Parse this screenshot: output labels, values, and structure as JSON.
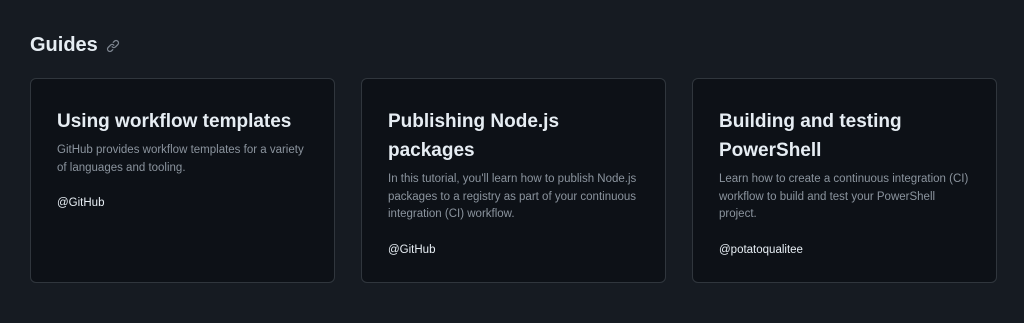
{
  "section": {
    "title": "Guides",
    "link_icon": "link-icon"
  },
  "cards": [
    {
      "title": "Using workflow templates",
      "description": "GitHub provides workflow templates for a variety of languages and tooling.",
      "author": "@GitHub"
    },
    {
      "title": "Publishing Node.js packages",
      "description": "In this tutorial, you'll learn how to publish Node.js packages to a registry as part of your continuous integration (CI) workflow.",
      "author": "@GitHub"
    },
    {
      "title": "Building and testing PowerShell",
      "description": "Learn how to create a continuous integration (CI) workflow to build and test your PowerShell project.",
      "author": "@potatoqualitee"
    }
  ],
  "colors": {
    "background": "#161b22",
    "card_background": "#0d1117",
    "card_border": "#30363d",
    "text_primary": "#e6edf3",
    "text_muted": "#8b949e"
  }
}
